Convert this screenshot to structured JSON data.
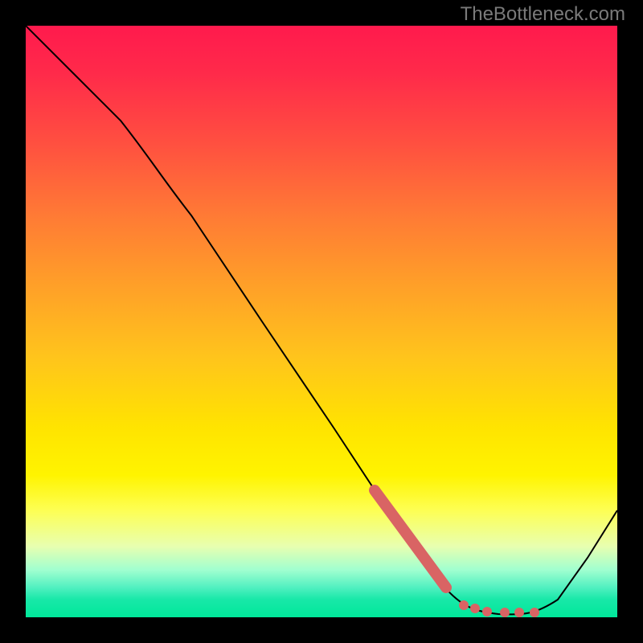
{
  "watermark": "TheBottleneck.com",
  "chart_data": {
    "type": "line",
    "title": "",
    "xlabel": "",
    "ylabel": "",
    "xlim": [
      0,
      1
    ],
    "ylim": [
      0,
      1
    ],
    "series": [
      {
        "name": "curve",
        "points": [
          {
            "x": 0.0,
            "y": 1.0
          },
          {
            "x": 0.08,
            "y": 0.92
          },
          {
            "x": 0.16,
            "y": 0.84
          },
          {
            "x": 0.22,
            "y": 0.77
          },
          {
            "x": 0.28,
            "y": 0.68
          },
          {
            "x": 0.4,
            "y": 0.5
          },
          {
            "x": 0.52,
            "y": 0.32
          },
          {
            "x": 0.62,
            "y": 0.17
          },
          {
            "x": 0.7,
            "y": 0.06
          },
          {
            "x": 0.75,
            "y": 0.02
          },
          {
            "x": 0.8,
            "y": 0.005
          },
          {
            "x": 0.86,
            "y": 0.005
          },
          {
            "x": 0.9,
            "y": 0.03
          },
          {
            "x": 0.95,
            "y": 0.1
          },
          {
            "x": 1.0,
            "y": 0.18
          }
        ]
      },
      {
        "name": "highlight-segment",
        "points": [
          {
            "x": 0.59,
            "y": 0.215
          },
          {
            "x": 0.71,
            "y": 0.05
          }
        ]
      },
      {
        "name": "highlight-dots",
        "points": [
          {
            "x": 0.74,
            "y": 0.02
          },
          {
            "x": 0.76,
            "y": 0.015
          },
          {
            "x": 0.78,
            "y": 0.01
          },
          {
            "x": 0.81,
            "y": 0.008
          },
          {
            "x": 0.835,
            "y": 0.008
          },
          {
            "x": 0.86,
            "y": 0.008
          }
        ]
      }
    ],
    "gradient_colors": {
      "top": "#ff1a4d",
      "mid_high": "#ffa028",
      "mid": "#ffe400",
      "mid_low": "#fdff55",
      "bottom": "#00e89a"
    },
    "highlight_color": "#d96464"
  }
}
